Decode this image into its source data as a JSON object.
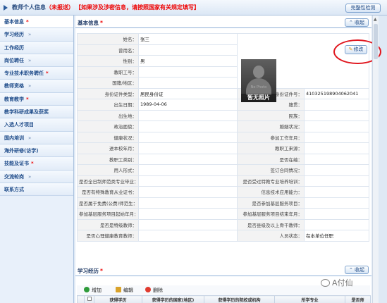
{
  "header": {
    "title": "教师个人信息",
    "status": "（未报送）",
    "notice": "【如果涉及涉密信息，请按照国家有关规定填写】",
    "check_button": "完整性检测"
  },
  "sidebar": {
    "items": [
      {
        "label": "基本信息",
        "star": "*",
        "arrow": ""
      },
      {
        "label": "学习经历",
        "star": "",
        "arrow": "»"
      },
      {
        "label": "工作经历",
        "star": "",
        "arrow": ""
      },
      {
        "label": "岗位聘任",
        "star": "",
        "arrow": "»"
      },
      {
        "label": "专业技术职务聘任",
        "star": "*",
        "arrow": ""
      },
      {
        "label": "教师资格",
        "star": "",
        "arrow": "»"
      },
      {
        "label": "教育教学",
        "star": "*",
        "arrow": ""
      },
      {
        "label": "教学科研成果及获奖",
        "star": "",
        "arrow": ""
      },
      {
        "label": "入选人才项目",
        "star": "",
        "arrow": ""
      },
      {
        "label": "国内培训",
        "star": "",
        "arrow": "»"
      },
      {
        "label": "海外研修(访学)",
        "star": "",
        "arrow": ""
      },
      {
        "label": "技能及证书",
        "star": "*",
        "arrow": ""
      },
      {
        "label": "交流轮岗",
        "star": "",
        "arrow": "»"
      },
      {
        "label": "联系方式",
        "star": "",
        "arrow": ""
      }
    ]
  },
  "basic": {
    "title": "基本信息",
    "star": "*",
    "collapse": "收起",
    "edit": "修改",
    "photo_caption": "暂无照片",
    "photo_small": "No Photo",
    "rows": [
      {
        "l1": "姓名：",
        "v1": "张三",
        "l2": "",
        "v2": ""
      },
      {
        "l1": "曾用名：",
        "v1": "",
        "l2": "",
        "v2": ""
      },
      {
        "l1": "性别：",
        "v1": "男",
        "l2": "",
        "v2": ""
      },
      {
        "l1": "教职工号：",
        "v1": "",
        "l2": "",
        "v2": ""
      },
      {
        "l1": "国籍/地区：",
        "v1": "",
        "l2": "",
        "v2": ""
      },
      {
        "l1": "身份证件类型：",
        "v1": "居民身份证",
        "l2": "身份证件号：",
        "v2": "410325198904062041"
      },
      {
        "l1": "出生日期：",
        "v1": "1989-04-06",
        "l2": "籍贯：",
        "v2": ""
      },
      {
        "l1": "出生地：",
        "v1": "",
        "l2": "民族：",
        "v2": ""
      },
      {
        "l1": "政治面貌：",
        "v1": "",
        "l2": "婚姻状况：",
        "v2": ""
      },
      {
        "l1": "健康状况：",
        "v1": "",
        "l2": "参加工作年月：",
        "v2": ""
      },
      {
        "l1": "进本校年月：",
        "v1": "",
        "l2": "教职工来源：",
        "v2": ""
      },
      {
        "l1": "教职工类别：",
        "v1": "",
        "l2": "是否在编：",
        "v2": ""
      },
      {
        "l1": "用人形式：",
        "v1": "",
        "l2": "签订合同情况：",
        "v2": ""
      },
      {
        "l1": "是否全日制师范类专业毕业：",
        "v1": "",
        "l2": "是否受过特教专业培养培训：",
        "v2": ""
      },
      {
        "l1": "是否有特殊教育从业证书：",
        "v1": "",
        "l2": "信息技术应用能力：",
        "v2": ""
      },
      {
        "l1": "是否属于免费(公费)师范生：",
        "v1": "",
        "l2": "是否参加基层服务项目：",
        "v2": ""
      },
      {
        "l1": "参加基层服务项目起始年月：",
        "v1": "",
        "l2": "参加基层服务项目结束年月：",
        "v2": ""
      },
      {
        "l1": "是否是特级教师：",
        "v1": "",
        "l2": "是否县级及以上骨干教师：",
        "v2": ""
      },
      {
        "l1": "是否心理健康教育教师：",
        "v1": "",
        "l2": "人员状态：",
        "v2": "在本单位任职"
      }
    ]
  },
  "study": {
    "title": "学习经历",
    "star": "*",
    "collapse": "收起",
    "toolbar": {
      "add": "增加",
      "edit": "编辑",
      "delete": "删除"
    },
    "columns": [
      "获得学历",
      "获得学历的国家(地区)",
      "获得学历的院校或机构",
      "所学专业",
      "是否师"
    ]
  },
  "watermark": "A付仙",
  "colors": {
    "accent": "#1f4c8a",
    "alert": "#e00000",
    "oval": "#e0161e"
  }
}
